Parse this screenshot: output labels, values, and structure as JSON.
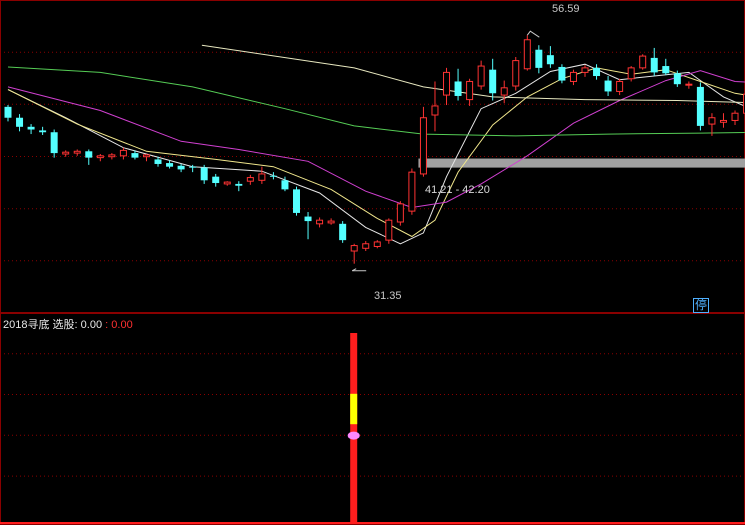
{
  "chart_data": {
    "type": "candlestick",
    "ylim": [
      28.5,
      58.5
    ],
    "high_label": "56.59",
    "low_label": "31.35",
    "range_label": "41.21 - 42.20",
    "stop_badge": "停",
    "candles": [
      [
        48.7,
        48.9,
        47.1,
        47.5
      ],
      [
        47.5,
        47.9,
        46.0,
        46.5
      ],
      [
        46.5,
        46.8,
        45.7,
        46.2
      ],
      [
        46.1,
        46.5,
        45.6,
        45.9
      ],
      [
        45.9,
        46.2,
        43.1,
        43.6
      ],
      [
        43.5,
        43.9,
        43.2,
        43.7
      ],
      [
        43.6,
        44.0,
        43.3,
        43.8
      ],
      [
        43.8,
        44.0,
        42.3,
        43.1
      ],
      [
        43.1,
        43.5,
        42.7,
        43.3
      ],
      [
        43.2,
        43.6,
        42.9,
        43.4
      ],
      [
        43.3,
        44.2,
        42.9,
        43.9
      ],
      [
        43.6,
        43.9,
        42.9,
        43.1
      ],
      [
        43.2,
        43.5,
        42.7,
        43.4
      ],
      [
        42.9,
        43.2,
        42.1,
        42.4
      ],
      [
        42.5,
        42.8,
        41.9,
        42.1
      ],
      [
        42.2,
        42.4,
        41.5,
        41.8
      ],
      [
        42.1,
        42.3,
        41.5,
        42.0
      ],
      [
        42.0,
        42.3,
        40.2,
        40.6
      ],
      [
        41.0,
        41.3,
        39.9,
        40.3
      ],
      [
        40.2,
        40.5,
        40.0,
        40.4
      ],
      [
        40.2,
        40.5,
        39.4,
        40.0
      ],
      [
        40.5,
        41.2,
        40.1,
        40.9
      ],
      [
        40.6,
        42.1,
        40.2,
        41.3
      ],
      [
        41.1,
        41.5,
        40.7,
        41.0
      ],
      [
        40.6,
        41.0,
        39.4,
        39.6
      ],
      [
        39.6,
        39.9,
        36.7,
        37.0
      ],
      [
        36.6,
        37.1,
        34.1,
        36.1
      ],
      [
        35.8,
        36.5,
        35.4,
        36.2
      ],
      [
        35.9,
        36.4,
        35.7,
        36.1
      ],
      [
        35.8,
        36.1,
        33.7,
        34.0
      ],
      [
        32.8,
        33.6,
        31.4,
        33.4
      ],
      [
        33.1,
        33.9,
        32.8,
        33.6
      ],
      [
        33.3,
        34.0,
        33.1,
        33.8
      ],
      [
        34.0,
        36.4,
        33.6,
        36.2
      ],
      [
        36.0,
        38.3,
        35.6,
        38.0
      ],
      [
        37.2,
        41.9,
        36.8,
        41.5
      ],
      [
        41.3,
        48.7,
        41.0,
        47.5
      ],
      [
        47.8,
        51.5,
        46.0,
        48.8
      ],
      [
        50.0,
        53.0,
        48.9,
        52.5
      ],
      [
        51.5,
        52.9,
        49.4,
        49.9
      ],
      [
        49.5,
        51.8,
        48.8,
        51.5
      ],
      [
        51.0,
        53.8,
        50.6,
        53.2
      ],
      [
        52.8,
        54.0,
        49.4,
        50.2
      ],
      [
        50.0,
        51.6,
        49.1,
        50.8
      ],
      [
        51.0,
        54.2,
        50.5,
        53.8
      ],
      [
        52.9,
        56.6,
        52.7,
        56.1
      ],
      [
        55.0,
        55.5,
        52.4,
        53.0
      ],
      [
        54.4,
        55.4,
        53.0,
        53.4
      ],
      [
        53.1,
        53.4,
        51.3,
        51.6
      ],
      [
        51.5,
        52.8,
        51.1,
        52.5
      ],
      [
        52.5,
        53.3,
        52.0,
        53.0
      ],
      [
        53.0,
        53.4,
        51.7,
        52.1
      ],
      [
        51.6,
        52.1,
        49.9,
        50.4
      ],
      [
        50.4,
        51.8,
        50.0,
        51.5
      ],
      [
        51.8,
        53.2,
        51.5,
        53.0
      ],
      [
        53.0,
        54.5,
        52.8,
        54.3
      ],
      [
        54.1,
        55.2,
        52.1,
        52.5
      ],
      [
        53.2,
        54.0,
        52.2,
        52.4
      ],
      [
        52.4,
        52.7,
        50.9,
        51.2
      ],
      [
        51.1,
        51.5,
        50.7,
        51.2
      ],
      [
        50.9,
        51.4,
        46.1,
        46.6
      ],
      [
        46.8,
        48.0,
        45.5,
        47.5
      ],
      [
        47.0,
        48.0,
        46.4,
        47.2
      ],
      [
        47.2,
        48.3,
        46.7,
        48.0
      ],
      [
        48.0,
        50.4,
        47.7,
        50.1
      ],
      [
        50.3,
        52.3,
        49.3,
        50.7
      ],
      [
        50.7,
        52.5,
        50.2,
        51.2
      ]
    ],
    "ma_lines": [
      {
        "color": "#e6e6e6",
        "values": [
          [
            0,
            50.6
          ],
          [
            5,
            47.5
          ],
          [
            10,
            44.2
          ],
          [
            16,
            42.1
          ],
          [
            22,
            41.6
          ],
          [
            27,
            39.2
          ],
          [
            31,
            35.4
          ],
          [
            34,
            33.6
          ],
          [
            36,
            34.8
          ],
          [
            38,
            41.0
          ],
          [
            41,
            48.5
          ],
          [
            44,
            50.2
          ],
          [
            47,
            52.6
          ],
          [
            50,
            53.4
          ],
          [
            53,
            51.7
          ],
          [
            56,
            52.1
          ],
          [
            59,
            52.5
          ],
          [
            62,
            49.8
          ],
          [
            64,
            48.7
          ],
          [
            66,
            49.4
          ]
        ]
      },
      {
        "color": "#f0e68c",
        "values": [
          [
            0,
            50.6
          ],
          [
            6,
            46.8
          ],
          [
            12,
            43.8
          ],
          [
            18,
            42.9
          ],
          [
            23,
            42.1
          ],
          [
            28,
            39.6
          ],
          [
            32,
            36.4
          ],
          [
            35,
            34.4
          ],
          [
            37,
            36.2
          ],
          [
            39,
            41.5
          ],
          [
            42,
            46.7
          ],
          [
            45,
            49.8
          ],
          [
            48,
            51.8
          ],
          [
            51,
            53.0
          ],
          [
            54,
            52.3
          ],
          [
            57,
            52.8
          ],
          [
            60,
            51.5
          ],
          [
            63,
            50.2
          ],
          [
            66,
            49.6
          ]
        ]
      },
      {
        "color": "#d040d0",
        "values": [
          [
            0,
            50.9
          ],
          [
            8,
            48.3
          ],
          [
            15,
            44.9
          ],
          [
            20,
            44.0
          ],
          [
            26,
            42.7
          ],
          [
            31,
            39.4
          ],
          [
            35,
            37.6
          ],
          [
            38,
            38.2
          ],
          [
            41,
            40.2
          ],
          [
            45,
            43.3
          ],
          [
            49,
            46.9
          ],
          [
            53,
            49.4
          ],
          [
            57,
            51.6
          ],
          [
            60,
            52.7
          ],
          [
            63,
            51.5
          ],
          [
            66,
            51.3
          ]
        ]
      },
      {
        "color": "#55cc55",
        "values": [
          [
            0,
            53.1
          ],
          [
            8,
            52.5
          ],
          [
            16,
            50.9
          ],
          [
            24,
            48.5
          ],
          [
            30,
            46.6
          ],
          [
            36,
            45.7
          ],
          [
            44,
            45.5
          ],
          [
            52,
            45.7
          ],
          [
            60,
            45.8
          ],
          [
            66,
            45.9
          ]
        ]
      },
      {
        "color": "#e8e8c0",
        "values": [
          [
            16.8,
            55.5
          ],
          [
            30,
            53.0
          ],
          [
            36,
            50.9
          ],
          [
            42,
            49.8
          ],
          [
            50,
            49.5
          ],
          [
            58,
            49.4
          ],
          [
            66,
            49.1
          ]
        ]
      }
    ],
    "support_band": [
      42.0,
      43.0
    ],
    "indicator": {
      "name": "2018寻底",
      "selection_label": "选股:",
      "value_white": "0.00",
      "value_red": "0.00",
      "signal_index": 30,
      "signal_total": 1.0,
      "segment_yellow_fraction": [
        0.52,
        0.68
      ],
      "marker_fraction": 0.46
    },
    "colors": {
      "up": "#ff3333",
      "down": "#54ffff",
      "grid": "#8a0000",
      "band": "#a0a0a0",
      "signal": "#ff1e1e",
      "signal_mid": "#ffff00",
      "marker": "#ff88ff"
    }
  }
}
